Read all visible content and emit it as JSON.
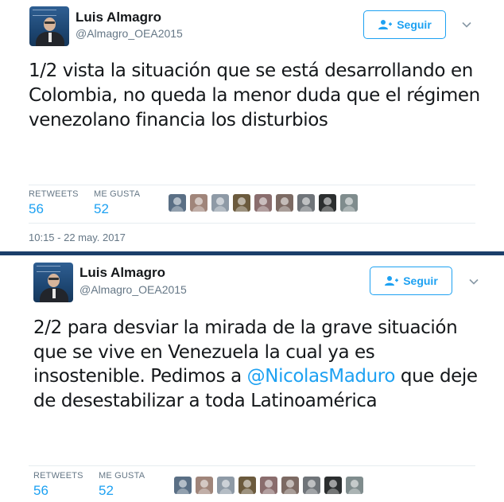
{
  "tweets": [
    {
      "author": {
        "name": "Luis Almagro",
        "handle": "@Almagro_OEA2015"
      },
      "follow_label": "Seguir",
      "text": "1/2 vista la situación que se está desarrollando en Colombia, no queda la menor duda que el régimen venezolano financia los disturbios",
      "stats": {
        "retweets_label": "RETWEETS",
        "retweets": "56",
        "likes_label": "ME GUSTA",
        "likes": "52"
      },
      "timestamp": "10:15 - 22 may. 2017"
    },
    {
      "author": {
        "name": "Luis Almagro",
        "handle": "@Almagro_OEA2015"
      },
      "follow_label": "Seguir",
      "text_before": "2/2 para desviar la mirada de la grave situación que se vive en Venezuela la cual ya es insostenible. Pedimos a ",
      "mention": "@NicolasMaduro",
      "text_after": " que deje de desestabilizar a toda Latinoamérica",
      "stats": {
        "retweets_label": "RETWEETS",
        "retweets": "56",
        "likes_label": "ME GUSTA",
        "likes": "52"
      }
    }
  ],
  "icons": {
    "follow": "person-plus-icon",
    "menu": "chevron-down-icon",
    "avatar": "profile-photo"
  },
  "colors": {
    "accent": "#1da1f2",
    "text": "#14171a",
    "muted": "#657786",
    "background": "#1b3f6a"
  },
  "liker_avatar_colors": [
    "#5a6f85",
    "#a0857a",
    "#8e9aa6",
    "#6b5a3d",
    "#8a6d6d",
    "#7c6a63",
    "#6f7479",
    "#2b2e2f",
    "#7f8c8d"
  ]
}
